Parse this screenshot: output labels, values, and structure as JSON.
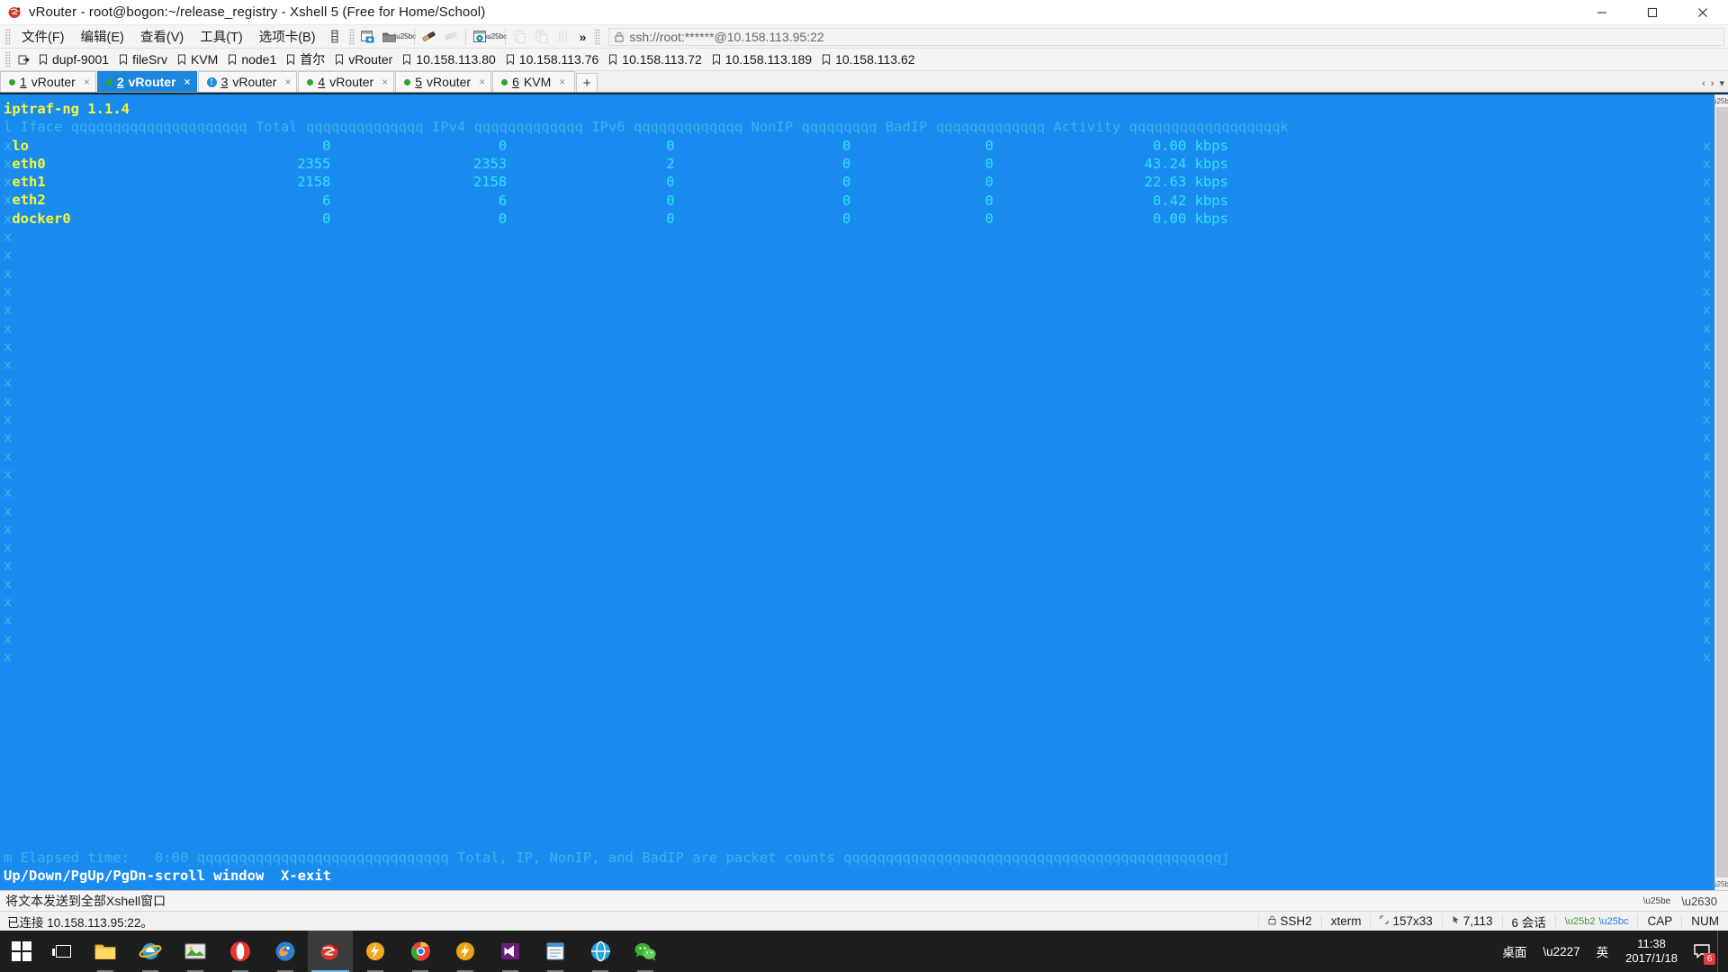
{
  "window": {
    "title": "vRouter - root@bogon:~/release_registry - Xshell 5 (Free for Home/School)",
    "app_icon": "xshell-icon",
    "minimize_label": "–",
    "maximize_label": "❐",
    "close_label": "✕"
  },
  "menu": {
    "items": [
      {
        "label": "文件(F)",
        "name": "menu-file"
      },
      {
        "label": "编辑(E)",
        "name": "menu-edit"
      },
      {
        "label": "查看(V)",
        "name": "menu-view"
      },
      {
        "label": "工具(T)",
        "name": "menu-tools"
      },
      {
        "label": "选项卡(B)",
        "name": "menu-tabs"
      }
    ],
    "overflow_label": "»"
  },
  "address": {
    "value": "ssh://root:******@10.158.113.95:22",
    "lock_icon": "lock-icon"
  },
  "bookmarks": {
    "items": [
      {
        "label": "dupf-9001"
      },
      {
        "label": "fileSrv"
      },
      {
        "label": "KVM"
      },
      {
        "label": "node1"
      },
      {
        "label": "首尔"
      },
      {
        "label": "vRouter"
      },
      {
        "label": "10.158.113.80"
      },
      {
        "label": "10.158.113.76"
      },
      {
        "label": "10.158.113.72"
      },
      {
        "label": "10.158.113.189"
      },
      {
        "label": "10.158.113.62"
      }
    ]
  },
  "tabs": {
    "items": [
      {
        "num": "1",
        "label": "vRouter",
        "active": false,
        "status": "dot",
        "close": "×"
      },
      {
        "num": "2",
        "label": "vRouter",
        "active": true,
        "status": "dot",
        "close": "×"
      },
      {
        "num": "3",
        "label": "vRouter",
        "active": false,
        "status": "info",
        "close": "×"
      },
      {
        "num": "4",
        "label": "vRouter",
        "active": false,
        "status": "dot",
        "close": "×"
      },
      {
        "num": "5",
        "label": "vRouter",
        "active": false,
        "status": "dot",
        "close": "×"
      },
      {
        "num": "6",
        "label": "KVM",
        "active": false,
        "status": "dot",
        "close": "×"
      }
    ],
    "add_label": "+",
    "scroll_left": "‹",
    "scroll_right": "›",
    "menu": "▾"
  },
  "terminal": {
    "app_title": "iptraf-ng 1.1.4",
    "header_line": "l Iface qqqqqqqqqqqqqqqqqqqqq Total qqqqqqqqqqqqqq IPv4 qqqqqqqqqqqqq IPv6 qqqqqqqqqqqqq NonIP qqqqqqqqq BadIP qqqqqqqqqqqqq Activity qqqqqqqqqqqqqqqqqqk",
    "columns": [
      "Iface",
      "Total",
      "IPv4",
      "IPv6",
      "NonIP",
      "BadIP",
      "Activity"
    ],
    "rows": [
      {
        "iface": "lo",
        "total": "0",
        "ipv4": "0",
        "ipv6": "0",
        "nonip": "0",
        "badip": "0",
        "activity": "0.00 kbps"
      },
      {
        "iface": "eth0",
        "total": "2355",
        "ipv4": "2353",
        "ipv6": "2",
        "nonip": "0",
        "badip": "0",
        "activity": "43.24 kbps"
      },
      {
        "iface": "eth1",
        "total": "2158",
        "ipv4": "2158",
        "ipv6": "0",
        "nonip": "0",
        "badip": "0",
        "activity": "22.63 kbps"
      },
      {
        "iface": "eth2",
        "total": "6",
        "ipv4": "6",
        "ipv6": "0",
        "nonip": "0",
        "badip": "0",
        "activity": "0.42 kbps"
      },
      {
        "iface": "docker0",
        "total": "0",
        "ipv4": "0",
        "ipv6": "0",
        "nonip": "0",
        "badip": "0",
        "activity": "0.00 kbps"
      }
    ],
    "left_border_char": "x",
    "right_border_char": "x",
    "footer_line": "m Elapsed time:   0:00 qqqqqqqqqqqqqqqqqqqqqqqqqqqqqq Total, IP, NonIP, and BadIP are packet counts qqqqqqqqqqqqqqqqqqqqqqqqqqqqqqqqqqqqqqqqqqqqqj",
    "keybar": "Up/Down/PgUp/PgDn-scroll window  X-exit"
  },
  "sendbar": {
    "text": "将文本发送到全部Xshell窗口",
    "collapse_icon": "chevron-down-icon",
    "menu_icon": "hamburger-icon"
  },
  "statusbar": {
    "connection": "已连接 10.158.113.95:22。",
    "protocol": "SSH2",
    "terminal_type": "xterm",
    "size": "157x33",
    "position": "7,113",
    "sessions": "6 会话",
    "cap": "CAP",
    "num": "NUM",
    "lock_icon": "lock-icon",
    "size_icon": "resize-icon",
    "cursor_icon": "cursor-icon",
    "up_icon": "arrow-up-icon",
    "down_icon": "arrow-down-icon"
  },
  "taskbar": {
    "start_icon": "windows-start-icon",
    "taskview_icon": "task-view-icon",
    "apps": [
      {
        "name": "file-explorer",
        "icon": "folder-icon",
        "color": "#f5c33c",
        "state": "running"
      },
      {
        "name": "internet-explorer",
        "icon": "ie-icon",
        "color": "#2a9fd8",
        "state": "running"
      },
      {
        "name": "media-player",
        "icon": "picture-icon",
        "color": "#3fa535",
        "state": "running"
      },
      {
        "name": "opera",
        "icon": "opera-icon",
        "color": "#e8352e",
        "state": "running"
      },
      {
        "name": "firefox",
        "icon": "firefox-icon",
        "color": "#2b7fd4",
        "state": "running"
      },
      {
        "name": "xshell",
        "icon": "xshell-icon",
        "color": "#c9302c",
        "state": "active"
      },
      {
        "name": "thunder",
        "icon": "thunder-icon",
        "color": "#f5a623",
        "state": "running"
      },
      {
        "name": "chrome",
        "icon": "chrome-icon",
        "color": "#3b7ddd",
        "state": "running"
      },
      {
        "name": "thunder2",
        "icon": "thunder-alt-icon",
        "color": "#e8a317",
        "state": "running"
      },
      {
        "name": "visual-studio",
        "icon": "vs-icon",
        "color": "#68217a",
        "state": "running"
      },
      {
        "name": "notepad",
        "icon": "notepad-icon",
        "color": "#4a90d9",
        "state": "running"
      },
      {
        "name": "browser-alt",
        "icon": "browser-icon",
        "color": "#2aa3d8",
        "state": "running"
      },
      {
        "name": "wechat",
        "icon": "wechat-icon",
        "color": "#3cb034",
        "state": "running"
      }
    ],
    "tray": {
      "desktop_label": "桌面",
      "expand_icon": "chevron-up-icon",
      "ime_label": "英",
      "time": "11:38",
      "date": "2017/1/18",
      "notification_count": "6"
    }
  }
}
